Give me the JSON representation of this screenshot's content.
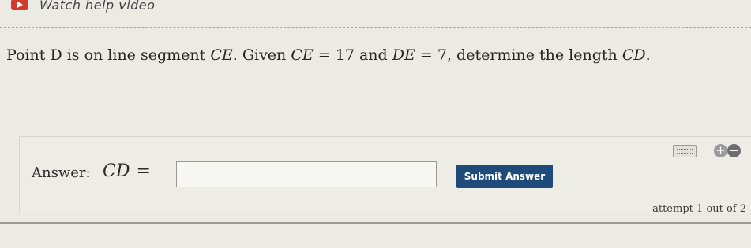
{
  "header": {
    "video_link_label": "Watch help video"
  },
  "question": {
    "text_part1": "Point D is on line segment ",
    "segment_ce": "CE",
    "text_part2": ". Given ",
    "ce_label": "CE",
    "ce_equals": " = 17",
    "text_and": " and ",
    "de_label": "DE",
    "de_equals": " = 7",
    "text_part3": ", determine the length ",
    "segment_cd": "CD",
    "text_end": "."
  },
  "answer": {
    "label": "Answer:",
    "lhs": "CD",
    "equals": "=",
    "input_value": "",
    "submit_label": "Submit Answer",
    "attempt_text": "attempt 1 out of 2"
  },
  "icons": {
    "keyboard": "keyboard-icon",
    "plus": "+",
    "minus": "−"
  },
  "colors": {
    "submit_bg": "#1e4b7a",
    "video_icon": "#d23a2e"
  }
}
